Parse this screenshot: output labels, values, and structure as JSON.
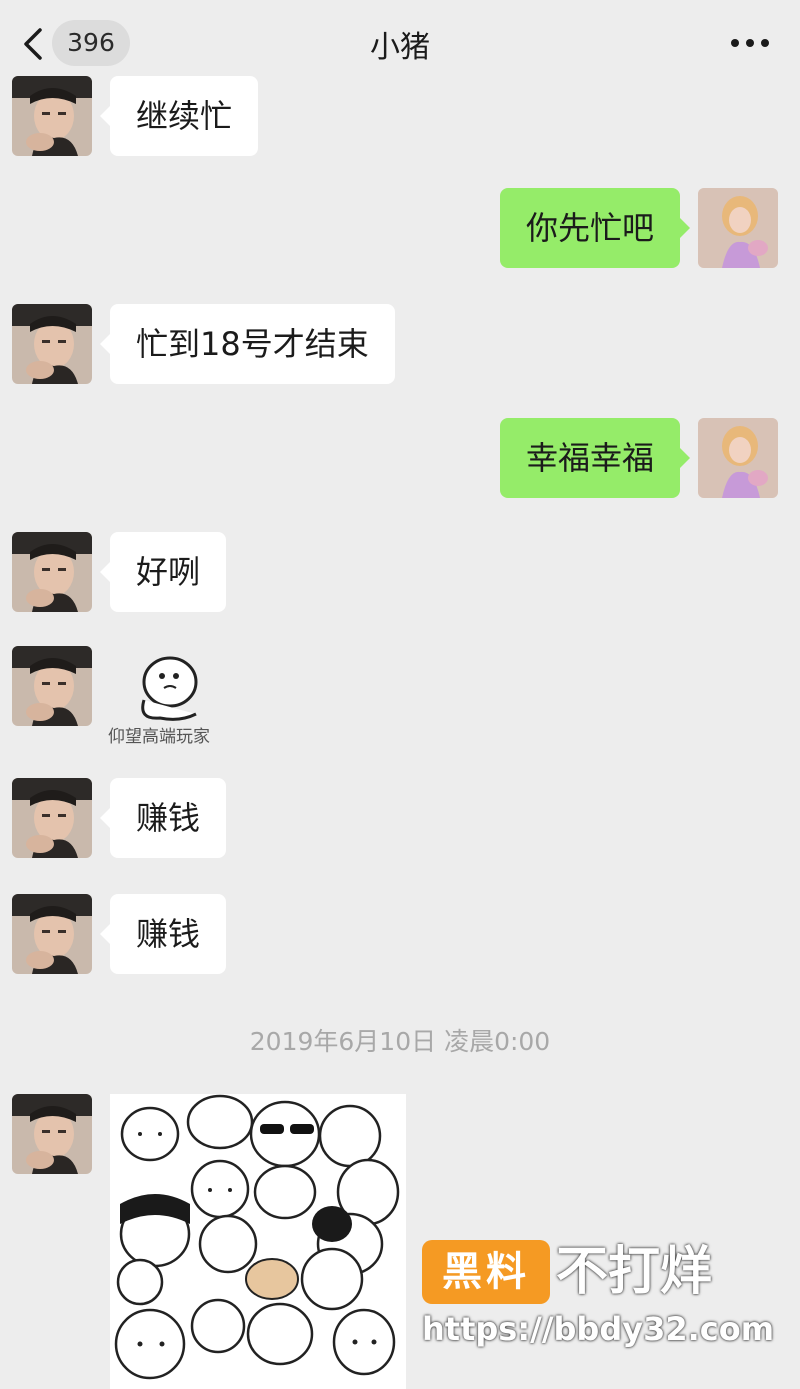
{
  "header": {
    "back_icon": "chevron-left-icon",
    "unread_count": "396",
    "title": "小猪",
    "more_icon": "more-dots-icon"
  },
  "messages": [
    {
      "side": "left",
      "text": "继续忙"
    },
    {
      "side": "right",
      "text": "你先忙吧"
    },
    {
      "side": "left",
      "text": "忙到18号才结束"
    },
    {
      "side": "right",
      "text": "幸福幸福"
    },
    {
      "side": "left",
      "text": "好咧"
    },
    {
      "side": "left",
      "type": "sticker",
      "caption": "仰望高端玩家"
    },
    {
      "side": "left",
      "text": "赚钱"
    },
    {
      "side": "left",
      "text": "赚钱"
    },
    {
      "side": "left",
      "type": "image"
    }
  ],
  "timestamp": "2019年6月10日 凌晨0:00",
  "watermark": {
    "box": "黑料",
    "text": "不打烊",
    "url": "https://bbdy32.com"
  },
  "colors": {
    "background": "#ededed",
    "self_bubble": "#95ec69",
    "other_bubble": "#ffffff",
    "watermark_accent": "#f59a23"
  }
}
